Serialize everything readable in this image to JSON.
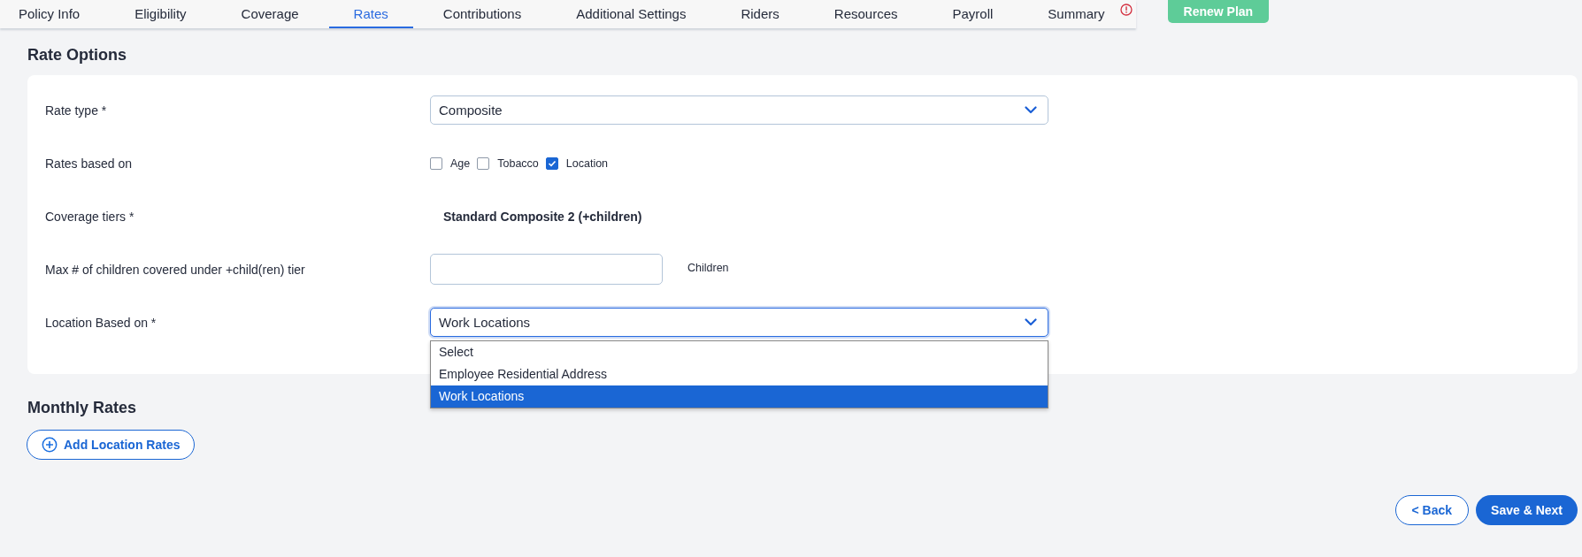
{
  "tabs": [
    {
      "label": "Policy Info",
      "selected": false,
      "alert": false
    },
    {
      "label": "Eligibility",
      "selected": false,
      "alert": false
    },
    {
      "label": "Coverage",
      "selected": false,
      "alert": false
    },
    {
      "label": "Rates",
      "selected": true,
      "alert": false
    },
    {
      "label": "Contributions",
      "selected": false,
      "alert": false
    },
    {
      "label": "Additional Settings",
      "selected": false,
      "alert": false
    },
    {
      "label": "Riders",
      "selected": false,
      "alert": false
    },
    {
      "label": "Resources",
      "selected": false,
      "alert": false
    },
    {
      "label": "Payroll",
      "selected": false,
      "alert": false
    },
    {
      "label": "Summary",
      "selected": false,
      "alert": true
    }
  ],
  "renew_button": "Renew Plan",
  "rate_options": {
    "title": "Rate Options",
    "rows": [
      {
        "kind": "select",
        "label": "Rate type *",
        "value": "Composite",
        "open": false
      },
      {
        "kind": "checkboxes",
        "label": "Rates based on",
        "options": [
          {
            "label": "Age",
            "checked": false
          },
          {
            "label": "Tobacco",
            "checked": false
          },
          {
            "label": "Location",
            "checked": true
          }
        ]
      },
      {
        "kind": "text",
        "label": "Coverage tiers *",
        "value": "Standard Composite 2 (+children)"
      },
      {
        "kind": "input",
        "label": "Max # of children covered under +child(ren) tier",
        "suffix": "Children"
      },
      {
        "kind": "select",
        "label": "Location Based on *",
        "value": "Work Locations",
        "open": true,
        "options": [
          {
            "label": "Select",
            "selected": false
          },
          {
            "label": "Employee Residential Address",
            "selected": false
          },
          {
            "label": "Work Locations",
            "selected": true
          }
        ]
      }
    ]
  },
  "monthly_rates": {
    "title": "Monthly Rates",
    "add_button": "Add Location Rates"
  },
  "footer": {
    "back": "< Back",
    "next": "Save & Next"
  }
}
